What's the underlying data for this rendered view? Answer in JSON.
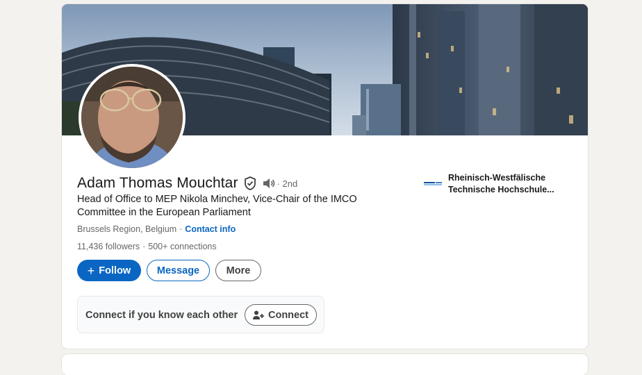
{
  "profile": {
    "name": "Adam Thomas Mouchtar",
    "degree": "· 2nd",
    "headline": "Head of Office to MEP Nikola Minchev, Vice-Chair of the IMCO Committee in the European Parliament",
    "location": "Brussels Region, Belgium",
    "location_separator": "·",
    "contact_info": "Contact info",
    "followers": "11,436 followers",
    "stats_separator": "·",
    "connections": "500+ connections"
  },
  "actions": {
    "follow_label": "Follow",
    "follow_icon": "+",
    "message_label": "Message",
    "more_label": "More"
  },
  "connect_prompt": {
    "text": "Connect if you know each other",
    "button_label": "Connect"
  },
  "education": {
    "name": "Rheinisch-Westfälische Technische Hochschule..."
  },
  "icons": {
    "verified": "verified-shield-icon",
    "speaker": "speaker-icon",
    "connect": "add-person-icon",
    "school_logo": "school-logo"
  },
  "colors": {
    "accent": "#0a66c2",
    "page_background": "#f4f2ee",
    "card_background": "#ffffff",
    "secondary_text": "#666666"
  }
}
